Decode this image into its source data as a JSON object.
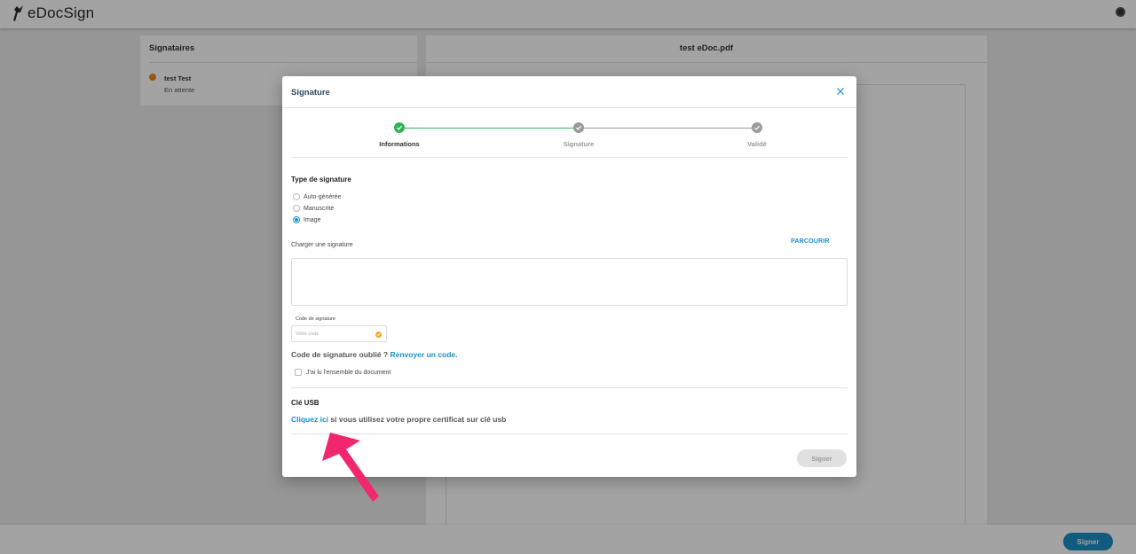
{
  "app": {
    "name": "eDocSign"
  },
  "signers_panel": {
    "title": "Signataires",
    "signers": [
      {
        "name": "test Test",
        "status": "En attente"
      }
    ]
  },
  "document": {
    "title": "test eDoc.pdf"
  },
  "footer": {
    "sign_label": "Signer"
  },
  "modal": {
    "title": "Signature",
    "steps": [
      {
        "label": "Informations",
        "state": "done"
      },
      {
        "label": "Signature",
        "state": "todo"
      },
      {
        "label": "Validé",
        "state": "todo"
      }
    ],
    "signature_type": {
      "title": "Type de signature",
      "options": [
        {
          "label": "Auto-générée",
          "checked": false
        },
        {
          "label": "Manuscrite",
          "checked": false
        },
        {
          "label": "Image",
          "checked": true
        }
      ]
    },
    "upload": {
      "label": "Charger une signature",
      "browse_label": "PARCOURIR"
    },
    "code": {
      "label": "Code de signature",
      "placeholder": "Votre code"
    },
    "forgot": {
      "text": "Code de signature oublié ?",
      "link": "Renvoyer un code."
    },
    "read_all": {
      "label": "J'ai lu l'ensemble du document"
    },
    "usb": {
      "title": "Clé USB",
      "link": "Cliquez ici",
      "text": "si vous utilisez votre propre certificat sur clé usb"
    },
    "sign_label": "Signer"
  },
  "colors": {
    "accent": "#1a8fc6",
    "step_done": "#2eb35a",
    "warning": "#e88a1a",
    "annotation_arrow": "#f0266e"
  }
}
